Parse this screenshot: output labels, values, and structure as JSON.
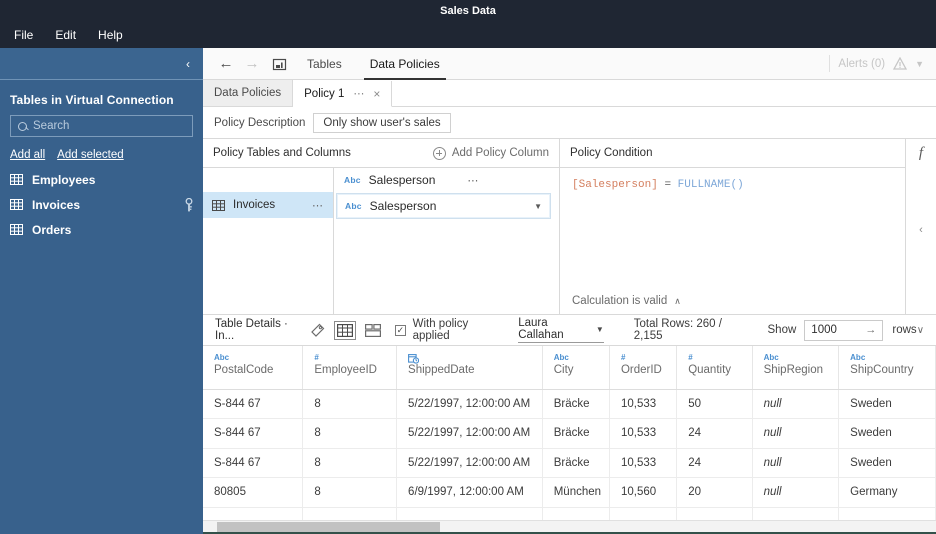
{
  "window": {
    "title": "Sales Data"
  },
  "menu": {
    "items": [
      "File",
      "Edit",
      "Help"
    ]
  },
  "sidebar": {
    "title": "Tables in Virtual Connection",
    "search_placeholder": "Search",
    "add_all": "Add all",
    "add_selected": "Add selected",
    "tables": [
      {
        "name": "Employees",
        "has_key": false
      },
      {
        "name": "Invoices",
        "has_key": true
      },
      {
        "name": "Orders",
        "has_key": false
      }
    ]
  },
  "toolbar": {
    "back_icon": "back-arrow-icon",
    "forward_icon": "forward-arrow-icon",
    "home_icon": "home-icon",
    "tabs": [
      {
        "label": "Tables",
        "active": false
      },
      {
        "label": "Data Policies",
        "active": true
      }
    ],
    "alerts_label": "Alerts (0)",
    "warning_icon": "warning-triangle-icon"
  },
  "tabstrip": {
    "tabs": [
      {
        "label": "Data Policies",
        "active": false,
        "closable": false
      },
      {
        "label": "Policy 1",
        "active": true,
        "closable": true,
        "dots": "⋯",
        "close": "×"
      }
    ]
  },
  "policy_description": {
    "label": "Policy Description",
    "value": "Only show user's sales"
  },
  "policy_tables": {
    "header": "Policy Tables and Columns",
    "add_column_label": "Add Policy Column",
    "column_header": {
      "type": "Abc",
      "name": "Salesperson",
      "dots": "⋯"
    },
    "table_row": {
      "name": "Invoices",
      "dots": "⋯"
    },
    "selected_column": {
      "type": "Abc",
      "name": "Salesperson",
      "caret": "▼"
    }
  },
  "policy_condition": {
    "header": "Policy Condition",
    "fx_icon": "function-fx-icon",
    "collapse_icon": "chevron-left-icon",
    "expression_field": "[Salesperson]",
    "expression_operator": "=",
    "expression_function": "FULLNAME()",
    "status": "Calculation is valid",
    "status_chevron": "∧"
  },
  "details": {
    "title": "Table Details · In...",
    "tag_icon": "tag-icon",
    "grid_icon": "grid-view-icon",
    "card_icon": "card-view-icon",
    "checkbox_label": "With policy applied",
    "checkbox_checked": true,
    "check_glyph": "✓",
    "user": "Laura Callahan",
    "user_caret": "▼",
    "total_rows": "Total Rows: 260 / 2,155",
    "show_label": "Show",
    "show_value": "1000",
    "show_arrow": "→",
    "rows_label": "rows",
    "rows_caret": "∨"
  },
  "grid": {
    "columns": [
      {
        "type": "Abc",
        "type_icon": "text-type-icon",
        "name": "PostalCode"
      },
      {
        "type": "#",
        "type_icon": "number-type-icon",
        "name": "EmployeeID"
      },
      {
        "type": "",
        "type_icon": "date-type-icon",
        "name": "ShippedDate"
      },
      {
        "type": "Abc",
        "type_icon": "text-type-icon",
        "name": "City"
      },
      {
        "type": "#",
        "type_icon": "number-type-icon",
        "name": "OrderID"
      },
      {
        "type": "#",
        "type_icon": "number-type-icon",
        "name": "Quantity"
      },
      {
        "type": "Abc",
        "type_icon": "text-type-icon",
        "name": "ShipRegion"
      },
      {
        "type": "Abc",
        "type_icon": "text-type-icon",
        "name": "ShipCountry"
      }
    ],
    "rows": [
      [
        "S-844 67",
        "8",
        "5/22/1997, 12:00:00 AM",
        "Bräcke",
        "10,533",
        "50",
        "null",
        "Sweden"
      ],
      [
        "S-844 67",
        "8",
        "5/22/1997, 12:00:00 AM",
        "Bräcke",
        "10,533",
        "24",
        "null",
        "Sweden"
      ],
      [
        "S-844 67",
        "8",
        "5/22/1997, 12:00:00 AM",
        "Bräcke",
        "10,533",
        "24",
        "null",
        "Sweden"
      ],
      [
        "80805",
        "8",
        "6/9/1997, 12:00:00 AM",
        "München",
        "10,560",
        "20",
        "null",
        "Germany"
      ],
      [
        "",
        "",
        "",
        "",
        "",
        "",
        "",
        ""
      ]
    ]
  },
  "colors": {
    "header_navy": "#1f2633",
    "sidebar_blue": "#38618c",
    "selection_blue": "#cfe6f7",
    "type_icon_blue": "#4a8fd0",
    "token_field": "#d47f5f",
    "token_function": "#7fa8d8"
  }
}
